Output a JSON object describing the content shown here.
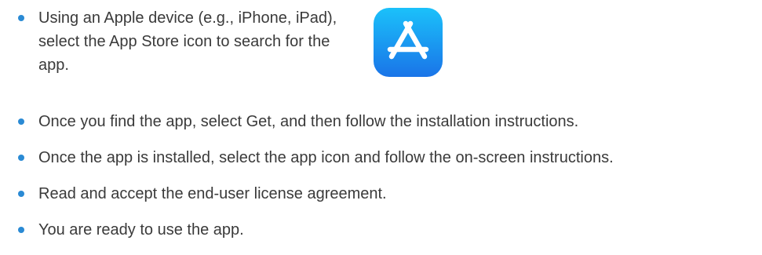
{
  "bullets": [
    {
      "text": "Using an Apple device (e.g., iPhone, iPad), select the App Store icon to search for the app."
    },
    {
      "text": "Once you find the app, select Get, and then follow the installation instructions."
    },
    {
      "text": "Once the app is installed, select the app icon and follow the on-screen instructions."
    },
    {
      "text": "Read and accept the end-user license agreement."
    },
    {
      "text": "You are ready to use the app."
    }
  ],
  "icon": {
    "name": "app-store-icon"
  },
  "colors": {
    "bullet": "#2a8ad4",
    "text": "#3a3a3a",
    "icon_top": "#1bc1fa",
    "icon_bottom": "#1a74e8"
  }
}
